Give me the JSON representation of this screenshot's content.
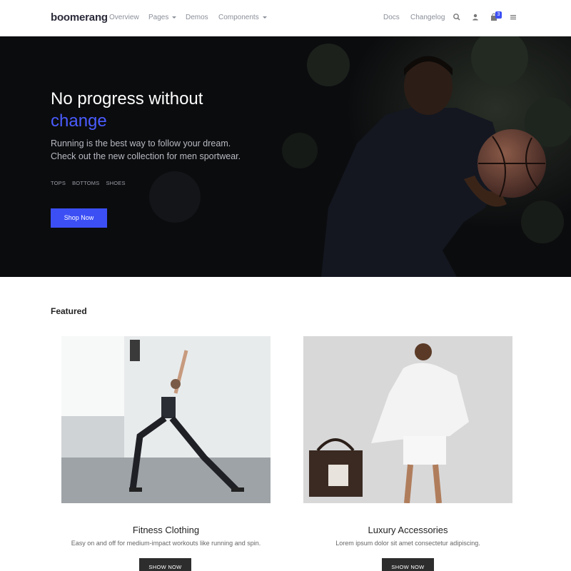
{
  "nav": {
    "brand": "boomerang",
    "links": [
      {
        "label": "Overview"
      },
      {
        "label": "Pages"
      },
      {
        "label": "Demos"
      },
      {
        "label": "Components"
      }
    ],
    "right_links": [
      {
        "label": "Docs"
      },
      {
        "label": "Changelog"
      }
    ],
    "cart_count": "3",
    "icons": [
      "search-icon",
      "user-icon",
      "shopping-bag-icon",
      "menu-icon"
    ]
  },
  "hero": {
    "title": "No progress without",
    "accent": "change",
    "subtitle_line1": "Running is the best way to follow your dream.",
    "subtitle_line2": "Check out the new collection for men sportwear.",
    "tags": [
      "TOPS",
      "BOTTOMS",
      "SHOES"
    ],
    "cta": "Shop Now"
  },
  "featured": {
    "heading": "Featured",
    "cards": [
      {
        "title": "Fitness Clothing",
        "description": "Easy on and off for medium-impact workouts like running and spin.",
        "button": "SHOW NOW"
      },
      {
        "title": "Luxury Accessories",
        "description": "Lorem ipsum dolor sit amet consectetur adipiscing.",
        "button": "SHOW NOW"
      }
    ]
  },
  "colors": {
    "accent": "#3c4ff5",
    "hero_bg": "#0b0c0e",
    "button_dark": "#2d2d2d"
  }
}
